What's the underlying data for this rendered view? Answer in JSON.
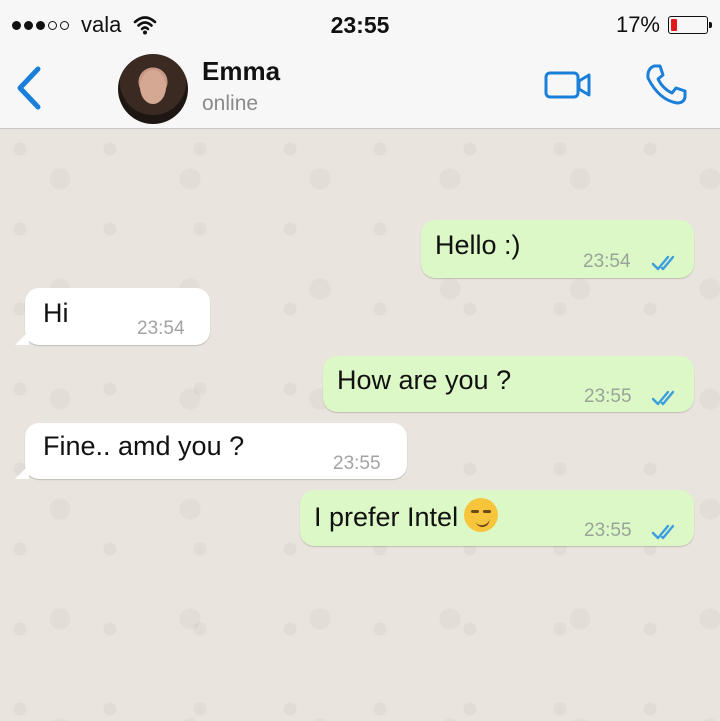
{
  "status_bar": {
    "carrier": "vala",
    "time": "23:55",
    "battery_text": "17%",
    "battery_level": 0.17,
    "signal_bars_filled": 3,
    "signal_bars_total": 5
  },
  "header": {
    "contact_name": "Emma",
    "contact_status": "online",
    "back_icon": "chevron-left-icon",
    "video_icon": "video-camera-icon",
    "call_icon": "phone-icon",
    "accent_color": "#1a7fd9"
  },
  "messages": [
    {
      "direction": "outgoing",
      "text": "Hello :)",
      "time": "23:54",
      "read": true
    },
    {
      "direction": "incoming",
      "text": "Hi",
      "time": "23:54"
    },
    {
      "direction": "outgoing",
      "text": "How are you ?",
      "time": "23:55",
      "read": true
    },
    {
      "direction": "incoming",
      "text": "Fine.. amd you ?",
      "time": "23:55"
    },
    {
      "direction": "outgoing",
      "text": "I prefer Intel",
      "emoji": "smirk-emoji",
      "time": "23:55",
      "read": true
    }
  ],
  "colors": {
    "outgoing_bubble": "#dcf8c6",
    "incoming_bubble": "#ffffff",
    "read_ticks": "#3a9ee0",
    "chat_background": "#e9e4dd"
  }
}
